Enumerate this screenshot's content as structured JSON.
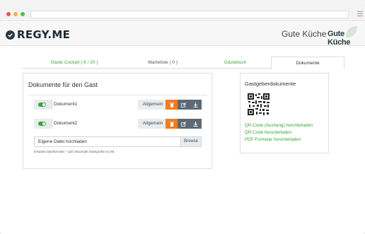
{
  "header": {
    "logo_text": "REGY.ME",
    "restaurant_name": "Gute Küche",
    "brand_logo_text": "Gute Küche"
  },
  "tabs": [
    {
      "label": "Gäste Cockpit ( 6 / 20 )"
    },
    {
      "label": "Warteliste ( 0 )"
    },
    {
      "label": "Gästebuch"
    },
    {
      "label": "Dokumente"
    }
  ],
  "guest_docs": {
    "title": "Dokumente für den Gast",
    "documents": [
      {
        "name": "Dokument1",
        "category": "Allgemein",
        "enabled": true
      },
      {
        "name": "Dokument2",
        "category": "Allgemein",
        "enabled": true
      }
    ],
    "upload_label": "Eigene Datei hochladen",
    "browse_label": "Browse",
    "hint": "Erlaubte dateiformate: *.pdf, Maximale Dateigröße ist 2M."
  },
  "host_docs": {
    "title": "Gastgeberdokumente",
    "links": [
      "QR-Code (Aushang) herunterladen",
      "QR-Code herunterladen",
      "PDF-Formular herunterladen"
    ]
  },
  "colors": {
    "accent_green": "#3aa53a",
    "delete_orange": "#f07d1f",
    "action_gray": "#5d6a75"
  },
  "icons": {
    "delete": "trash-icon",
    "edit": "edit-icon",
    "download": "download-icon"
  }
}
